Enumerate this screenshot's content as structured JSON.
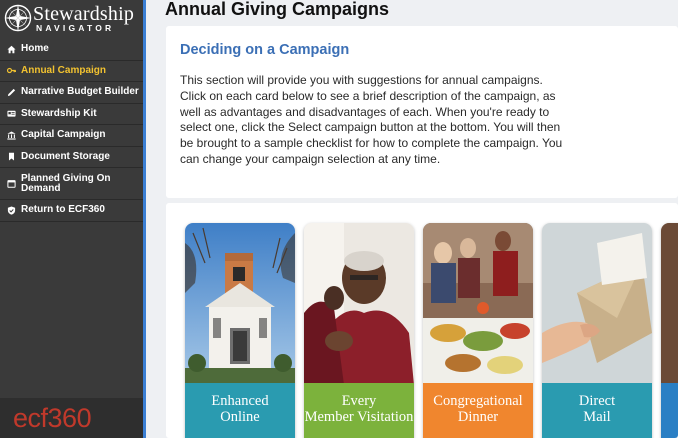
{
  "brand": {
    "title": "Stewardship",
    "subtitle": "NAVIGATOR"
  },
  "sidebar": {
    "items": [
      {
        "label": "Home",
        "icon": "home-icon",
        "active": false
      },
      {
        "label": "Annual Campaign",
        "icon": "key-icon",
        "active": true
      },
      {
        "label": "Narrative Budget Builder",
        "icon": "pencil-icon",
        "active": false
      },
      {
        "label": "Stewardship Kit",
        "icon": "id-card-icon",
        "active": false
      },
      {
        "label": "Capital Campaign",
        "icon": "bank-icon",
        "active": false
      },
      {
        "label": "Document Storage",
        "icon": "bookmark-icon",
        "active": false
      },
      {
        "label": "Planned Giving On Demand",
        "icon": "calendar-icon",
        "active": false
      },
      {
        "label": "Return to ECF360",
        "icon": "shield-check-icon",
        "active": false
      }
    ],
    "footer_logo": {
      "prefix": "ecf",
      "number": "360"
    }
  },
  "main": {
    "title": "Annual Giving Campaigns",
    "intro": {
      "heading": "Deciding on a Campaign",
      "text": "This section will provide you with suggestions for annual campaigns. Click on each card below to see a brief description of the campaign, as well as advantages and disadvantages of each. When you're ready to select one, click the Select campaign button at the bottom. You will then be brought to a sample checklist for how to complete the campaign. You can change your campaign selection at any time."
    },
    "cards": [
      {
        "label": "Enhanced Online",
        "color": "#2a9bb0"
      },
      {
        "label": "Every Member Visitation",
        "color": "#7cb23c"
      },
      {
        "label": "Congregational Dinner",
        "color": "#f0862e"
      },
      {
        "label": "Direct Mail",
        "color": "#2a9bb0"
      },
      {
        "label": "",
        "color": "#2a7fc4"
      }
    ]
  },
  "colors": {
    "sidebar_bg": "#3a3a3a",
    "active_nav": "#f2c230",
    "accent_blue": "#3b7fd4",
    "heading_blue": "#3b6fb5",
    "ecf_red": "#c0392b"
  }
}
